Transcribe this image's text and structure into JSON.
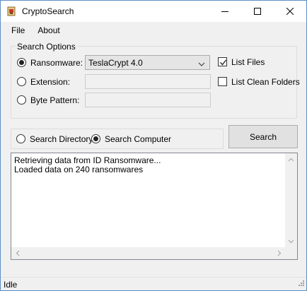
{
  "window": {
    "title": "CryptoSearch",
    "accent_color": "#5f8fc4"
  },
  "menu": {
    "items": [
      {
        "label": "File"
      },
      {
        "label": "About"
      }
    ]
  },
  "search_options": {
    "group_label": "Search Options",
    "ransomware": {
      "label": "Ransomware:",
      "selected": "TeslaCrypt 4.0",
      "checked": true
    },
    "extension": {
      "label": "Extension:",
      "value": "",
      "checked": false
    },
    "byte_pattern": {
      "label": "Byte Pattern:",
      "value": "",
      "checked": false
    },
    "list_files": {
      "label": "List Files",
      "checked": true
    },
    "list_clean_folders": {
      "label": "List Clean Folders",
      "checked": false
    }
  },
  "scope": {
    "search_directory": {
      "label": "Search Directory",
      "checked": false
    },
    "search_computer": {
      "label": "Search Computer",
      "checked": true
    }
  },
  "search_button": {
    "label": "Search"
  },
  "log": {
    "lines": [
      "Retrieving data from ID Ransomware...",
      "Loaded data on 240 ransomwares"
    ]
  },
  "status": {
    "text": "Idle"
  },
  "icons": {
    "app": "lock-icon",
    "minimize": "minimize-icon",
    "maximize": "maximize-icon",
    "close": "close-icon",
    "dropdown": "chevron-down-icon",
    "check": "checkmark-icon",
    "resize": "resize-grip-icon"
  }
}
